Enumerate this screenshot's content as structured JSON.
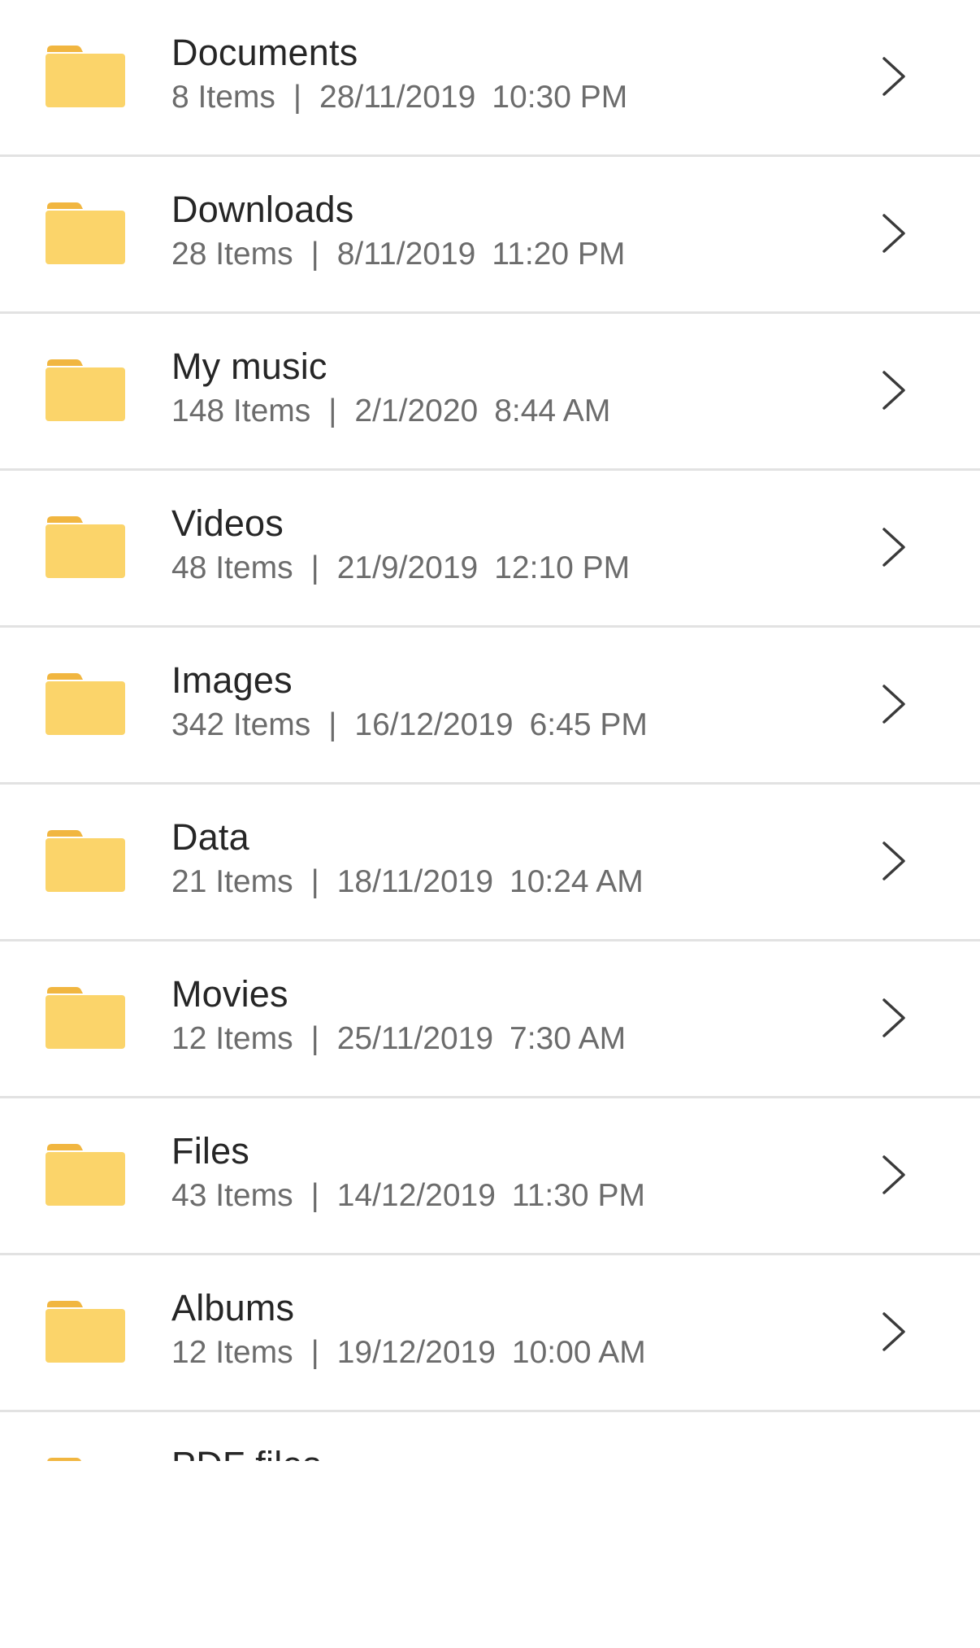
{
  "colors": {
    "folder_body": "#fbd46a",
    "folder_tab": "#f1b640",
    "divider": "#e2e2e2",
    "title_text": "#262626",
    "meta_text": "#6c6c6c",
    "chevron": "#3a3a3a"
  },
  "icons": {
    "folder": "folder-icon",
    "chevron": "chevron-right-icon"
  },
  "folders": [
    {
      "name": "Documents",
      "count": "8 Items",
      "separator": "|",
      "date": "28/11/2019",
      "time": "10:30 PM"
    },
    {
      "name": "Downloads",
      "count": "28 Items",
      "separator": "|",
      "date": "8/11/2019",
      "time": "11:20 PM"
    },
    {
      "name": "My music",
      "count": "148 Items",
      "separator": "|",
      "date": "2/1/2020",
      "time": "8:44 AM"
    },
    {
      "name": "Videos",
      "count": "48 Items",
      "separator": "|",
      "date": "21/9/2019",
      "time": "12:10 PM"
    },
    {
      "name": "Images",
      "count": "342 Items",
      "separator": "|",
      "date": "16/12/2019",
      "time": "6:45 PM"
    },
    {
      "name": "Data",
      "count": "21 Items",
      "separator": "|",
      "date": "18/11/2019",
      "time": "10:24 AM"
    },
    {
      "name": "Movies",
      "count": "12 Items",
      "separator": "|",
      "date": "25/11/2019",
      "time": "7:30 AM"
    },
    {
      "name": "Files",
      "count": "43 Items",
      "separator": "|",
      "date": "14/12/2019",
      "time": "11:30 PM"
    },
    {
      "name": "Albums",
      "count": "12 Items",
      "separator": "|",
      "date": "19/12/2019",
      "time": "10:00 AM"
    },
    {
      "name": "PDF files",
      "count": "",
      "separator": "",
      "date": "",
      "time": ""
    }
  ]
}
